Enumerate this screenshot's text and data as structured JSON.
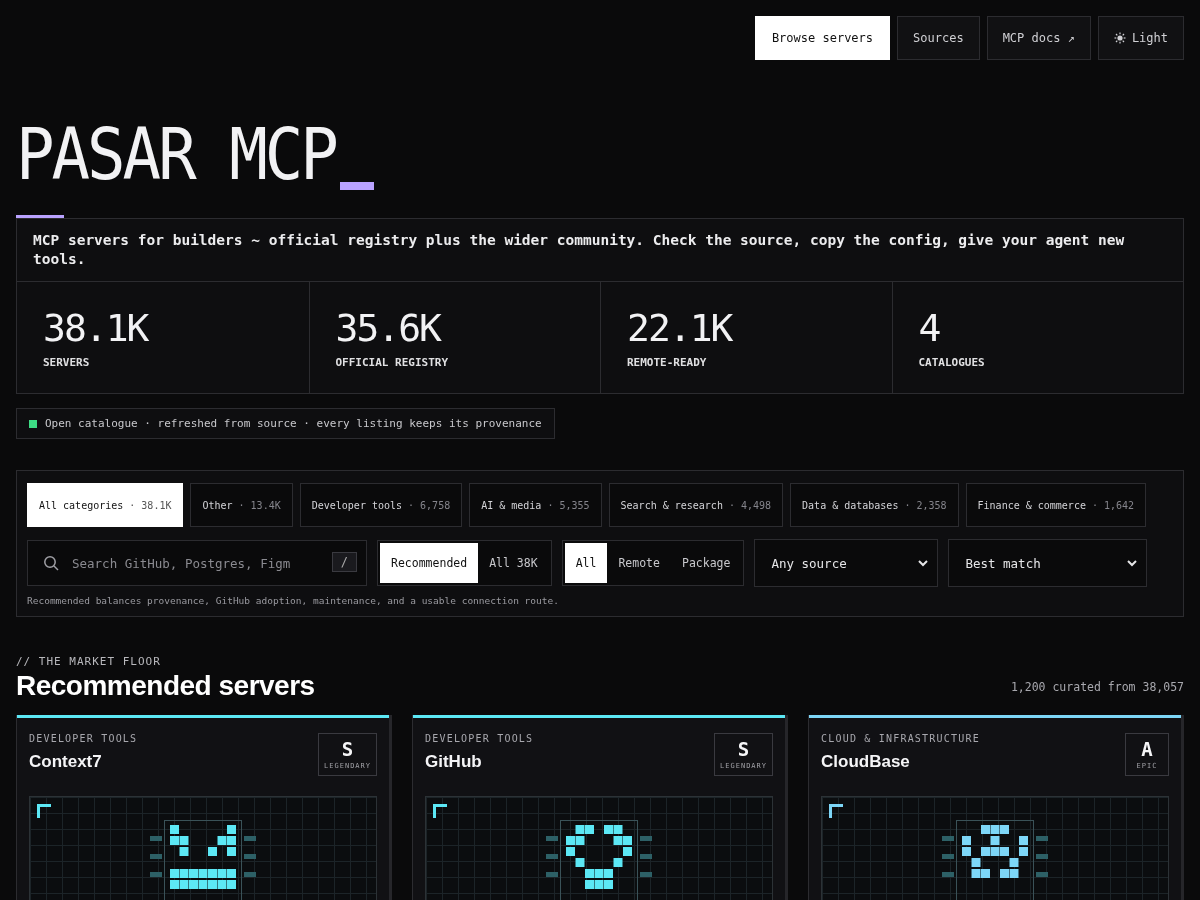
{
  "nav": [
    {
      "label": "Browse servers",
      "selected": true,
      "kind": "link"
    },
    {
      "label": "Sources",
      "selected": false,
      "kind": "link"
    },
    {
      "label": "MCP docs ↗",
      "selected": false,
      "kind": "link"
    },
    {
      "label": "Light",
      "selected": false,
      "kind": "theme"
    }
  ],
  "hero": {
    "title": "PASAR MCP",
    "description": "MCP servers for builders ~ official registry plus the wider community. Check the source, copy the config, give your agent new tools."
  },
  "stats": [
    {
      "value": "38.1K",
      "label": "SERVERS"
    },
    {
      "value": "35.6K",
      "label": "OFFICIAL REGISTRY"
    },
    {
      "value": "22.1K",
      "label": "REMOTE-READY"
    },
    {
      "value": "4",
      "label": "CATALOGUES"
    }
  ],
  "status": {
    "text": "Open catalogue · refreshed from source · every listing keeps its provenance",
    "color": "#3ddc84"
  },
  "filters": {
    "categories": [
      {
        "label": "All categories",
        "count": "· 38.1K",
        "selected": true
      },
      {
        "label": "Other",
        "count": "· 13.4K",
        "selected": false
      },
      {
        "label": "Developer tools",
        "count": "· 6,758",
        "selected": false
      },
      {
        "label": "AI & media",
        "count": "· 5,355",
        "selected": false
      },
      {
        "label": "Search & research",
        "count": "· 4,498",
        "selected": false
      },
      {
        "label": "Data & databases",
        "count": "· 2,358",
        "selected": false
      },
      {
        "label": "Finance & commerce",
        "count": "· 1,642",
        "selected": false
      }
    ],
    "search": {
      "placeholder": "Search GitHub, Postgres, Figm",
      "shortcut": "/"
    },
    "sort_modes": [
      {
        "label": "Recommended",
        "selected": true
      },
      {
        "label": "All 38K",
        "selected": false
      }
    ],
    "transports": [
      {
        "label": "All",
        "selected": true
      },
      {
        "label": "Remote",
        "selected": false
      },
      {
        "label": "Package",
        "selected": false
      }
    ],
    "source_select": "Any source",
    "order_select": "Best match",
    "hint": "Recommended balances provenance, GitHub adoption, maintenance, and a usable connection route."
  },
  "section": {
    "eyebrow": "// THE MARKET FLOOR",
    "title": "Recommended servers",
    "count": "1,200 curated from 38,057"
  },
  "cards": [
    {
      "category": "DEVELOPER TOOLS",
      "name": "Context7",
      "tier": "S",
      "rarity": "LEGENDARY",
      "color": "#5ce8f5"
    },
    {
      "category": "DEVELOPER TOOLS",
      "name": "GitHub",
      "tier": "S",
      "rarity": "LEGENDARY",
      "color": "#5ce8f5"
    },
    {
      "category": "CLOUD & INFRASTRUCTURE",
      "name": "CloudBase",
      "tier": "A",
      "rarity": "EPIC",
      "color": "#7dd6f7"
    }
  ]
}
